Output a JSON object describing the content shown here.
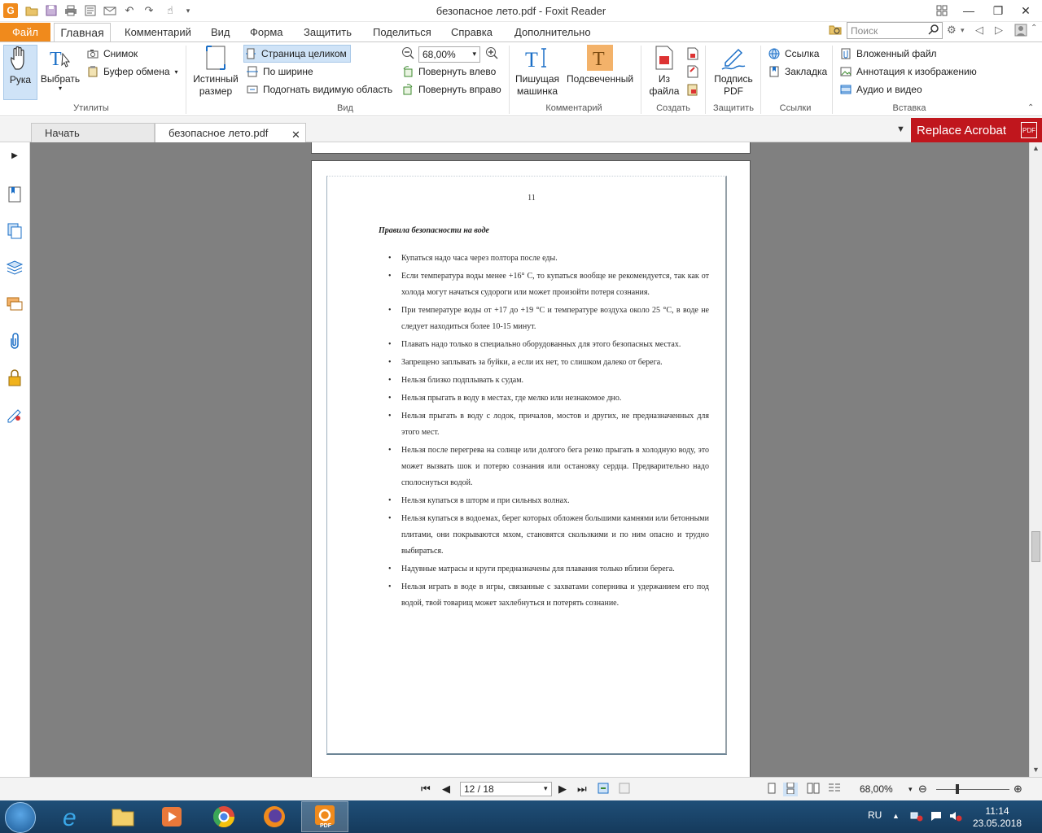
{
  "window": {
    "title": "безопасное лето.pdf - Foxit Reader",
    "logo_letter": "G"
  },
  "menu": {
    "file": "Файл",
    "tabs": [
      "Главная",
      "Комментарий",
      "Вид",
      "Форма",
      "Защитить",
      "Поделиться",
      "Справка",
      "Дополнительно"
    ],
    "search_placeholder": "Поиск"
  },
  "ribbon": {
    "utilities": {
      "label": "Утилиты",
      "hand": "Рука",
      "select": "Выбрать",
      "snapshot": "Снимок",
      "clipboard": "Буфер обмена"
    },
    "view": {
      "label": "Вид",
      "actual_size_line1": "Истинный",
      "actual_size_line2": "размер",
      "fit_page": "Страница целиком",
      "fit_width": "По ширине",
      "fit_visible": "Подогнать видимую область",
      "zoom_value": "68,00%",
      "rotate_left": "Повернуть влево",
      "rotate_right": "Повернуть вправо"
    },
    "comment": {
      "label": "Комментарий",
      "typewriter_line1": "Пишущая",
      "typewriter_line2": "машинка",
      "highlight": "Подсвеченный"
    },
    "create": {
      "label": "Создать",
      "from_file_line1": "Из",
      "from_file_line2": "файла"
    },
    "protect": {
      "label": "Защитить",
      "sign_line1": "Подпись",
      "sign_line2": "PDF"
    },
    "links": {
      "label": "Ссылки",
      "link": "Ссылка",
      "bookmark": "Закладка"
    },
    "insert": {
      "label": "Вставка",
      "attachment": "Вложенный файл",
      "image_annotation": "Аннотация к изображению",
      "audio_video": "Аудио и видео"
    }
  },
  "tabs": {
    "start": "Начать",
    "document": "безопасное лето.pdf",
    "replace_acrobat": "Replace Acrobat",
    "pdf_badge": "PDF"
  },
  "document": {
    "page_number": "11",
    "heading": "Правила безопасности на воде",
    "rules": [
      "Купаться надо часа через полтора после еды.",
      "Если температура воды менее +16° С, то купаться вообще не рекомендуется, так как от холода могут начаться судороги или может произойти потеря сознания.",
      "При температуре воды от +17 до +19 °С и температуре воздуха около 25 °С, в воде не следует находиться более 10-15 минут.",
      "Плавать надо только в специально оборудованных для этого безопасных местах.",
      "Запрещено заплывать за буйки, а если их нет, то слишком далеко от берега.",
      "Нельзя близко подплывать к судам.",
      "Нельзя прыгать в воду в местах, где мелко или незнакомое дно.",
      "Нельзя прыгать в воду с лодок, причалов, мостов и других, не предназначенных для этого мест.",
      "Нельзя после перегрева на солнце или долгого бега резко прыгать в холодную воду, это может вызвать шок и потерю сознания или остановку сердца. Предварительно надо сполоснуться водой.",
      "Нельзя купаться в шторм и при сильных волнах.",
      "Нельзя купаться в водоемах, берег которых обложен большими камнями или бетонными плитами, они покрываются мхом, становятся скользкими и по ним опасно и трудно выбираться.",
      "Надувные матрасы и круги предназначены для плавания только вблизи берега.",
      "Нельзя играть в воде в игры, связанные с захватами соперника и удержанием его под водой, твой товарищ может захлебнуться и потерять сознание."
    ]
  },
  "status": {
    "page_indicator": "12 / 18",
    "zoom": "68,00%",
    "zoom_fraction": 0.29
  },
  "taskbar": {
    "lang": "RU",
    "time": "11:14",
    "date": "23.05.2018",
    "foxit_label": "PDF"
  },
  "colors": {
    "accent": "#f08a1c",
    "selected": "#cfe3f7",
    "replace_acrobat": "#c0161d"
  }
}
